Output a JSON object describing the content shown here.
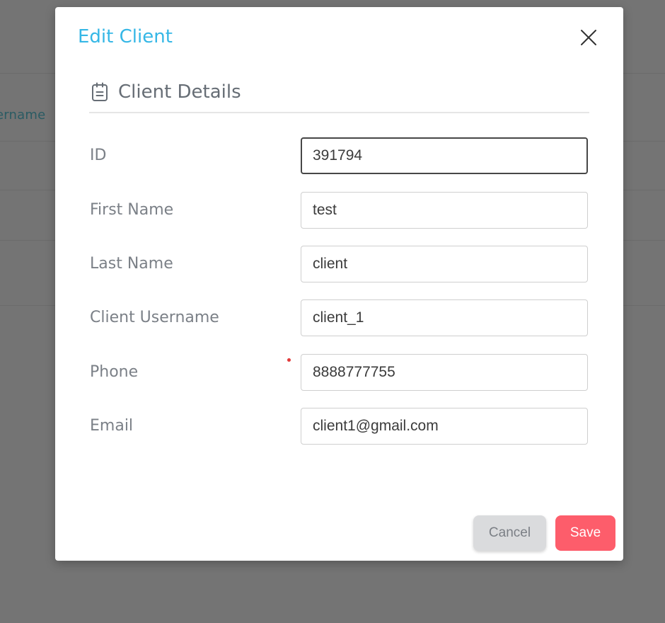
{
  "background": {
    "column_header_fragment": "ername"
  },
  "modal": {
    "title": "Edit Client",
    "section_title": "Client Details",
    "fields": [
      {
        "label": "ID",
        "value": "391794"
      },
      {
        "label": "First Name",
        "value": "test"
      },
      {
        "label": "Last Name",
        "value": "client"
      },
      {
        "label": "Client Username",
        "value": "client_1"
      },
      {
        "label": "Phone",
        "value": "8888777755"
      },
      {
        "label": "Email",
        "value": "client1@gmail.com"
      }
    ],
    "buttons": {
      "cancel": "Cancel",
      "save": "Save"
    },
    "icons": {
      "close": "close-icon",
      "section": "clipboard-list-icon"
    }
  },
  "colors": {
    "title": "#35b7e6",
    "save": "#fd5d6b",
    "cancel": "#dadbdd",
    "required_dot": "#e23b3b",
    "overlay": "#747474"
  }
}
